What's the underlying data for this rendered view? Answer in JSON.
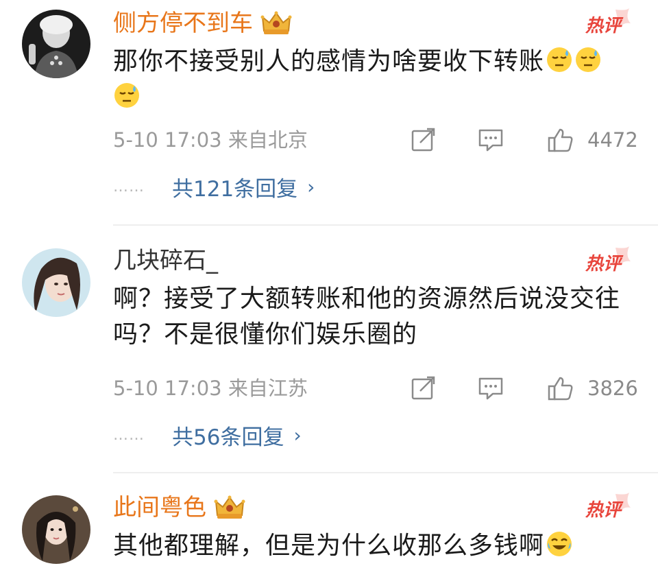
{
  "comments": [
    {
      "username": "侧方停不到车",
      "text": "那你不接受别人的感情为啥要收下转账",
      "emojis": [
        "sweat-face-emoji",
        "sweat-face-emoji",
        "sweat-face-emoji"
      ],
      "time": "5-10 17:03",
      "location": "来自北京",
      "likes": "4472",
      "replies": "共121条回复",
      "hot_label": "热评",
      "vip": true
    },
    {
      "username": "几块碎石_",
      "text": "啊？接受了大额转账和他的资源然后说没交往吗？不是很懂你们娱乐圈的",
      "emojis": [],
      "time": "5-10 17:03",
      "location": "来自江苏",
      "likes": "3826",
      "replies": "共56条回复",
      "hot_label": "热评",
      "vip": false
    },
    {
      "username": "此间粤色",
      "text": "其他都理解，但是为什么收那么多钱啊",
      "emojis": [
        "laugh-cry-emoji"
      ],
      "hot_label": "热评",
      "vip": true
    }
  ],
  "icons": {
    "repost": "repost-icon",
    "comment": "comment-icon",
    "like": "like-icon",
    "crown": "crown-badge-icon"
  },
  "colors": {
    "vip_name": "#e8761a",
    "hot_badge": "#e8453c",
    "reply_link": "#3f6ea0",
    "meta_gray": "#9a9a9a"
  },
  "reply_dots": "……"
}
